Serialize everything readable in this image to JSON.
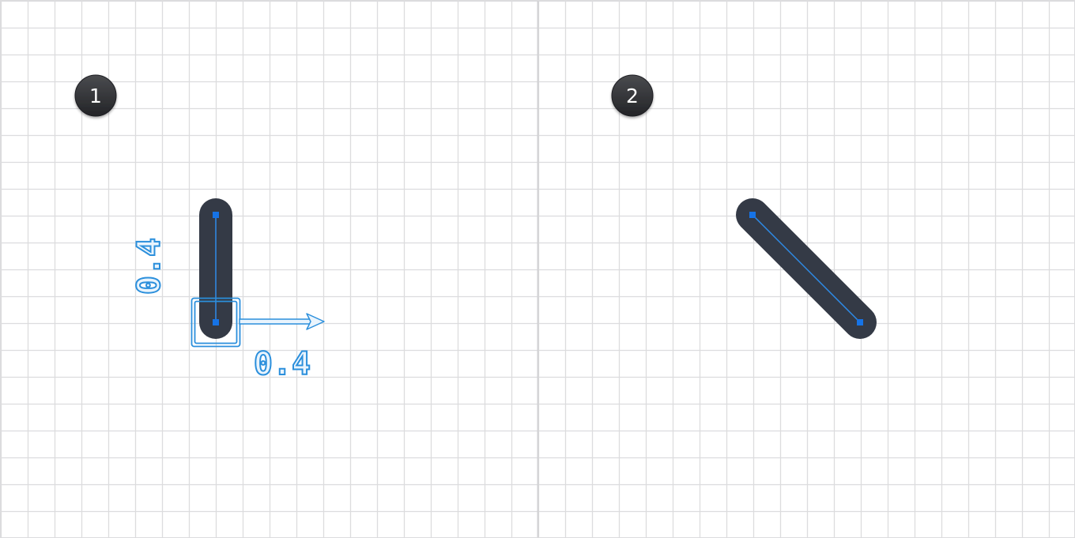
{
  "panels": [
    {
      "step_number": "1",
      "measure": {
        "vertical_label": "0.4",
        "horizontal_label": "0.4"
      }
    },
    {
      "step_number": "2"
    }
  ],
  "colors": {
    "grid_line": "#dcdcde",
    "panel_divider": "#d2d2d4",
    "badge_fill": "#2f3033",
    "stroke_shape": "#343a46",
    "path_line": "#2e8be8",
    "anchor_point": "#1673e6",
    "measure_accent": "#2b8fdc"
  }
}
